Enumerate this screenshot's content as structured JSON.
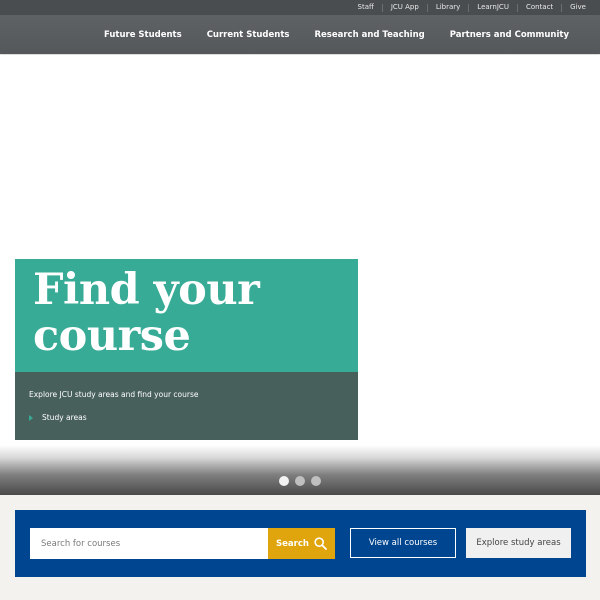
{
  "utility_nav": {
    "links": [
      "Staff",
      "JCU App",
      "Library",
      "LearnJCU",
      "Contact",
      "Give"
    ]
  },
  "main_nav": {
    "items": [
      "Future Students",
      "Current Students",
      "Research and Teaching",
      "Partners and Community"
    ]
  },
  "hero": {
    "title_line1": "Find your",
    "title_line2": "course",
    "description": "Explore JCU study areas and find your course",
    "link_label": "Study areas",
    "slides_total": 3,
    "active_slide": 1
  },
  "search_panel": {
    "input_placeholder": "Search for courses",
    "input_value": "",
    "search_button_label": "Search",
    "view_all_label": "View all courses",
    "explore_label": "Explore study areas"
  },
  "colors": {
    "utility_bar": "#4a4d50",
    "nav_bar": "#5a5d60",
    "hero_card_teal": "#37ab96",
    "hero_card_dark": "#48605c",
    "panel_blue": "#00458f",
    "search_yellow": "#e0a50d",
    "page_background": "#f3f2ee"
  },
  "icons": {
    "search": "search-icon",
    "link_arrow": "chevron-right-icon"
  }
}
